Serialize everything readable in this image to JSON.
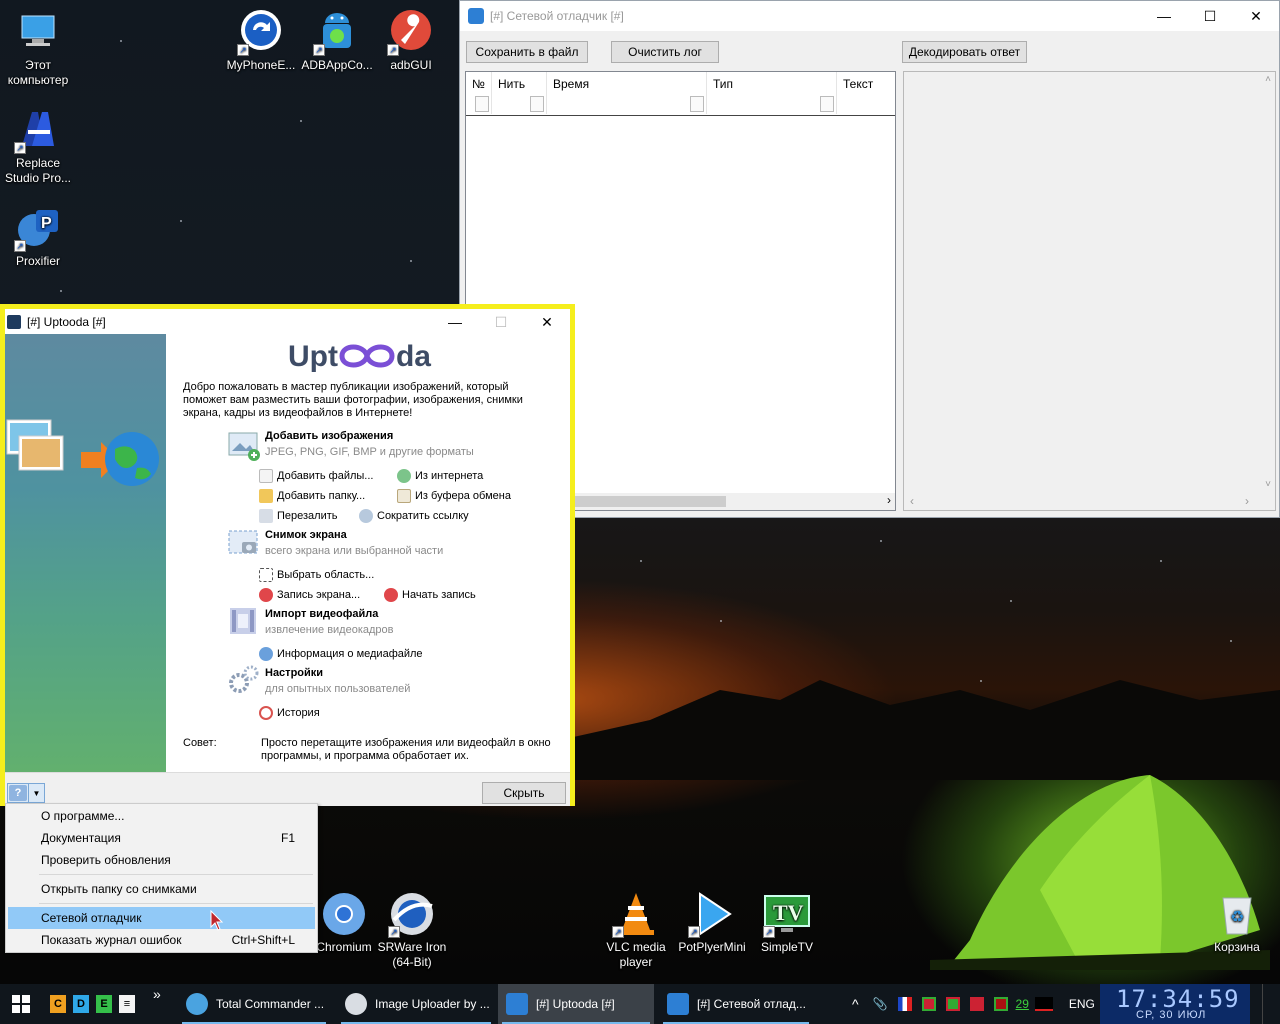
{
  "desktop": {
    "icons": [
      {
        "id": "this-pc",
        "label": "Этот компьютер"
      },
      {
        "id": "myphone",
        "label": "MyPhoneE..."
      },
      {
        "id": "adbappco",
        "label": "ADBAppCo..."
      },
      {
        "id": "adbgui",
        "label": "adbGUI"
      },
      {
        "id": "replace-studio",
        "label": "Replace Studio Pro..."
      },
      {
        "id": "proxifier",
        "label": "Proxifier"
      },
      {
        "id": "chromium",
        "label": "Chromium"
      },
      {
        "id": "srware",
        "label": "SRWare Iron (64-Bit)"
      },
      {
        "id": "vlc",
        "label": "VLC media player"
      },
      {
        "id": "potplayer",
        "label": "PotPlyerMini"
      },
      {
        "id": "simpletv",
        "label": "SimpleTV"
      },
      {
        "id": "recycle",
        "label": "Корзина"
      }
    ]
  },
  "debugger": {
    "title": "[#] Сетевой отладчик [#]",
    "save_label": "Сохранить в файл",
    "clear_label": "Очистить лог",
    "decode_label": "Декодировать ответ",
    "columns": [
      "№",
      "Нить",
      "Время",
      "Тип",
      "Текст"
    ]
  },
  "uptooda": {
    "title": "[#] Uptooda [#]",
    "logo_pre": "Upt",
    "logo_post": "da",
    "intro": "Добро пожаловать в мастер публикации изображений, который поможет вам разместить ваши фотографии, изображения, снимки экрана, кадры из видеофайлов в Интернете!",
    "sections": {
      "add": {
        "title": "Добавить изображения",
        "sub": "JPEG, PNG, GIF, BMP и другие форматы"
      },
      "screen": {
        "title": "Снимок экрана",
        "sub": "всего экрана или выбранной части"
      },
      "video": {
        "title": "Импорт видеофайла",
        "sub": "извлечение видеокадров"
      },
      "settings": {
        "title": "Настройки",
        "sub": "для опытных пользователей"
      }
    },
    "links": {
      "add_files": "Добавить файлы...",
      "from_internet": "Из интернета",
      "add_folder": "Добавить папку...",
      "from_clipboard": "Из буфера обмена",
      "reupload": "Перезалить",
      "shorten": "Сократить ссылку",
      "select_area": "Выбрать область...",
      "record_screen": "Запись экрана...",
      "start_record": "Начать запись",
      "media_info": "Информация о медиафайле",
      "history": "История"
    },
    "tip_label": "Совет:",
    "tip_text": "Просто перетащите изображения или видеофайл в окно программы, и программа обработает их.",
    "hide_label": "Скрыть",
    "help_icon": "?"
  },
  "context_menu": {
    "items": [
      {
        "label": "О программе...",
        "shortcut": ""
      },
      {
        "label": "Документация",
        "shortcut": "F1"
      },
      {
        "label": "Проверить обновления",
        "shortcut": ""
      },
      {
        "label": "Открыть папку со снимками",
        "shortcut": ""
      },
      {
        "label": "Сетевой отладчик",
        "shortcut": ""
      },
      {
        "label": "Показать журнал ошибок",
        "shortcut": "Ctrl+Shift+L"
      }
    ]
  },
  "taskbar": {
    "quicklaunch": [
      "C",
      "D",
      "E"
    ],
    "overflow": "»",
    "tasks": [
      {
        "label": "Total Commander ..."
      },
      {
        "label": "Image Uploader by ..."
      },
      {
        "label": "[#] Uptooda [#]"
      },
      {
        "label": "[#] Сетевой отлад..."
      }
    ],
    "tray_chevron": "^",
    "tray_number": "29",
    "language": "ENG",
    "time": "17:34:59",
    "date": "СР, 30 ИЮЛ"
  },
  "colors": {
    "highlight_border": "#f5ee1d",
    "menu_highlight": "#91c9f7",
    "clock_bg": "#0c2a66",
    "taskbar_bg": "#10161c"
  }
}
